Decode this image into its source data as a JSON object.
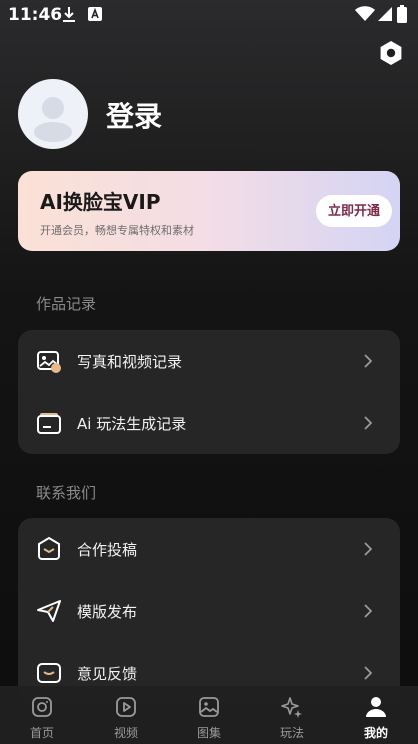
{
  "status_bar": {
    "time": "11:46"
  },
  "profile": {
    "login_label": "登录"
  },
  "vip_banner": {
    "title": "AI换脸宝VIP",
    "subtitle": "开通会员，畅想专属特权和素材",
    "button_label": "立即开通"
  },
  "records_section": {
    "title": "作品记录",
    "items": [
      {
        "label": "写真和视频记录",
        "icon": "photo-record-icon"
      },
      {
        "label": "Ai 玩法生成记录",
        "icon": "ai-record-icon"
      }
    ]
  },
  "contact_section": {
    "title": "联系我们",
    "items": [
      {
        "label": "合作投稿",
        "icon": "submit-icon"
      },
      {
        "label": "模版发布",
        "icon": "send-icon"
      },
      {
        "label": "意见反馈",
        "icon": "feedback-icon"
      }
    ]
  },
  "tab_bar": {
    "tabs": [
      {
        "label": "首页",
        "icon": "home-icon"
      },
      {
        "label": "视频",
        "icon": "video-icon"
      },
      {
        "label": "图集",
        "icon": "gallery-icon"
      },
      {
        "label": "玩法",
        "icon": "sparkle-icon"
      },
      {
        "label": "我的",
        "icon": "person-icon"
      }
    ],
    "active_tab": "我的"
  },
  "colors": {
    "background": "#141414",
    "card": "#262626",
    "accent_button_text": "#7d2b4a",
    "section_title": "#8a8a8a"
  }
}
